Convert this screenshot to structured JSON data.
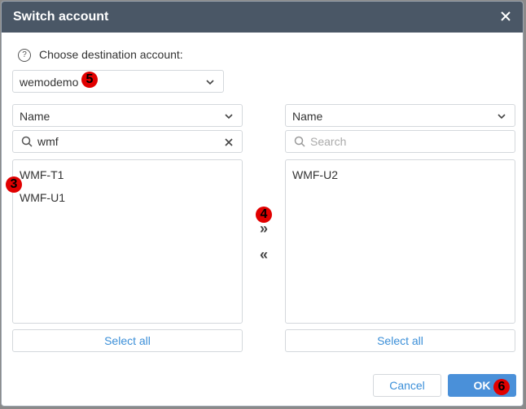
{
  "dialog": {
    "title": "Switch account",
    "close_icon": "close-icon"
  },
  "destination": {
    "label": "Choose destination account:",
    "help_icon": "?",
    "selected_account": "wemodemo"
  },
  "left_panel": {
    "sort_field": "Name",
    "search_value": "wmf",
    "items": [
      "WMF-T1",
      "WMF-U1"
    ],
    "select_all_label": "Select all"
  },
  "right_panel": {
    "sort_field": "Name",
    "search_placeholder": "Search",
    "items": [
      "WMF-U2"
    ],
    "select_all_label": "Select all"
  },
  "transfer": {
    "move_right": "»",
    "move_left": "«"
  },
  "footer": {
    "cancel_label": "Cancel",
    "ok_label": "OK"
  },
  "annotations": {
    "badge_3": "3",
    "badge_4": "4",
    "badge_5": "5",
    "badge_6": "6"
  },
  "colors": {
    "header": "#4a5766",
    "accent": "#4a90d9",
    "link": "#3b8fd8",
    "badge": "#e10000"
  }
}
